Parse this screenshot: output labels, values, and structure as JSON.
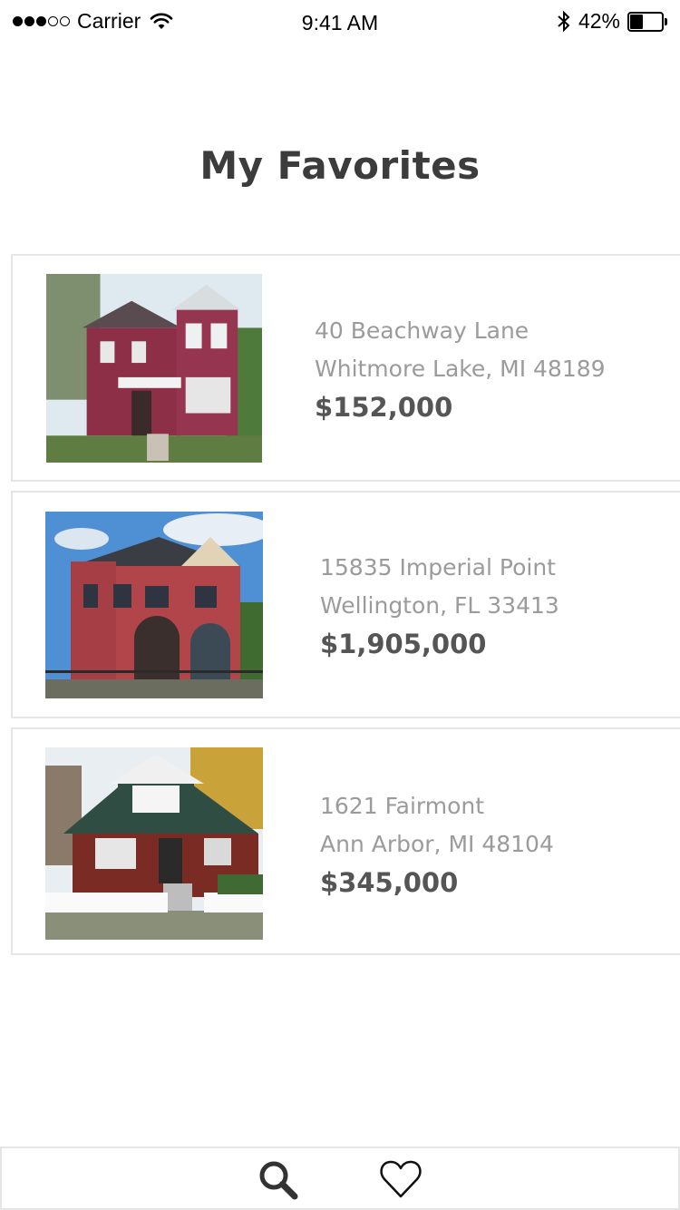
{
  "status_bar": {
    "carrier": "Carrier",
    "time": "9:41 AM",
    "battery_text": "42%",
    "battery_level": 0.42,
    "signal_bars_filled": 3,
    "signal_bars_total": 5
  },
  "header": {
    "title": "My Favorites"
  },
  "listings": [
    {
      "street": "40 Beachway Lane",
      "city": "Whitmore Lake, MI 48189",
      "price": "$152,000"
    },
    {
      "street": "15835 Imperial Point",
      "city": "Wellington, FL 33413",
      "price": "$1,905,000"
    },
    {
      "street": "1621 Fairmont",
      "city": "Ann Arbor, MI 48104",
      "price": "$345,000"
    }
  ],
  "tab_bar": {
    "items": [
      {
        "icon": "search-icon"
      },
      {
        "icon": "heart-icon"
      }
    ]
  },
  "colors": {
    "title": "#3c3c3c",
    "address": "#9b9b9b",
    "price": "#555555",
    "border": "#e5e5e5"
  }
}
